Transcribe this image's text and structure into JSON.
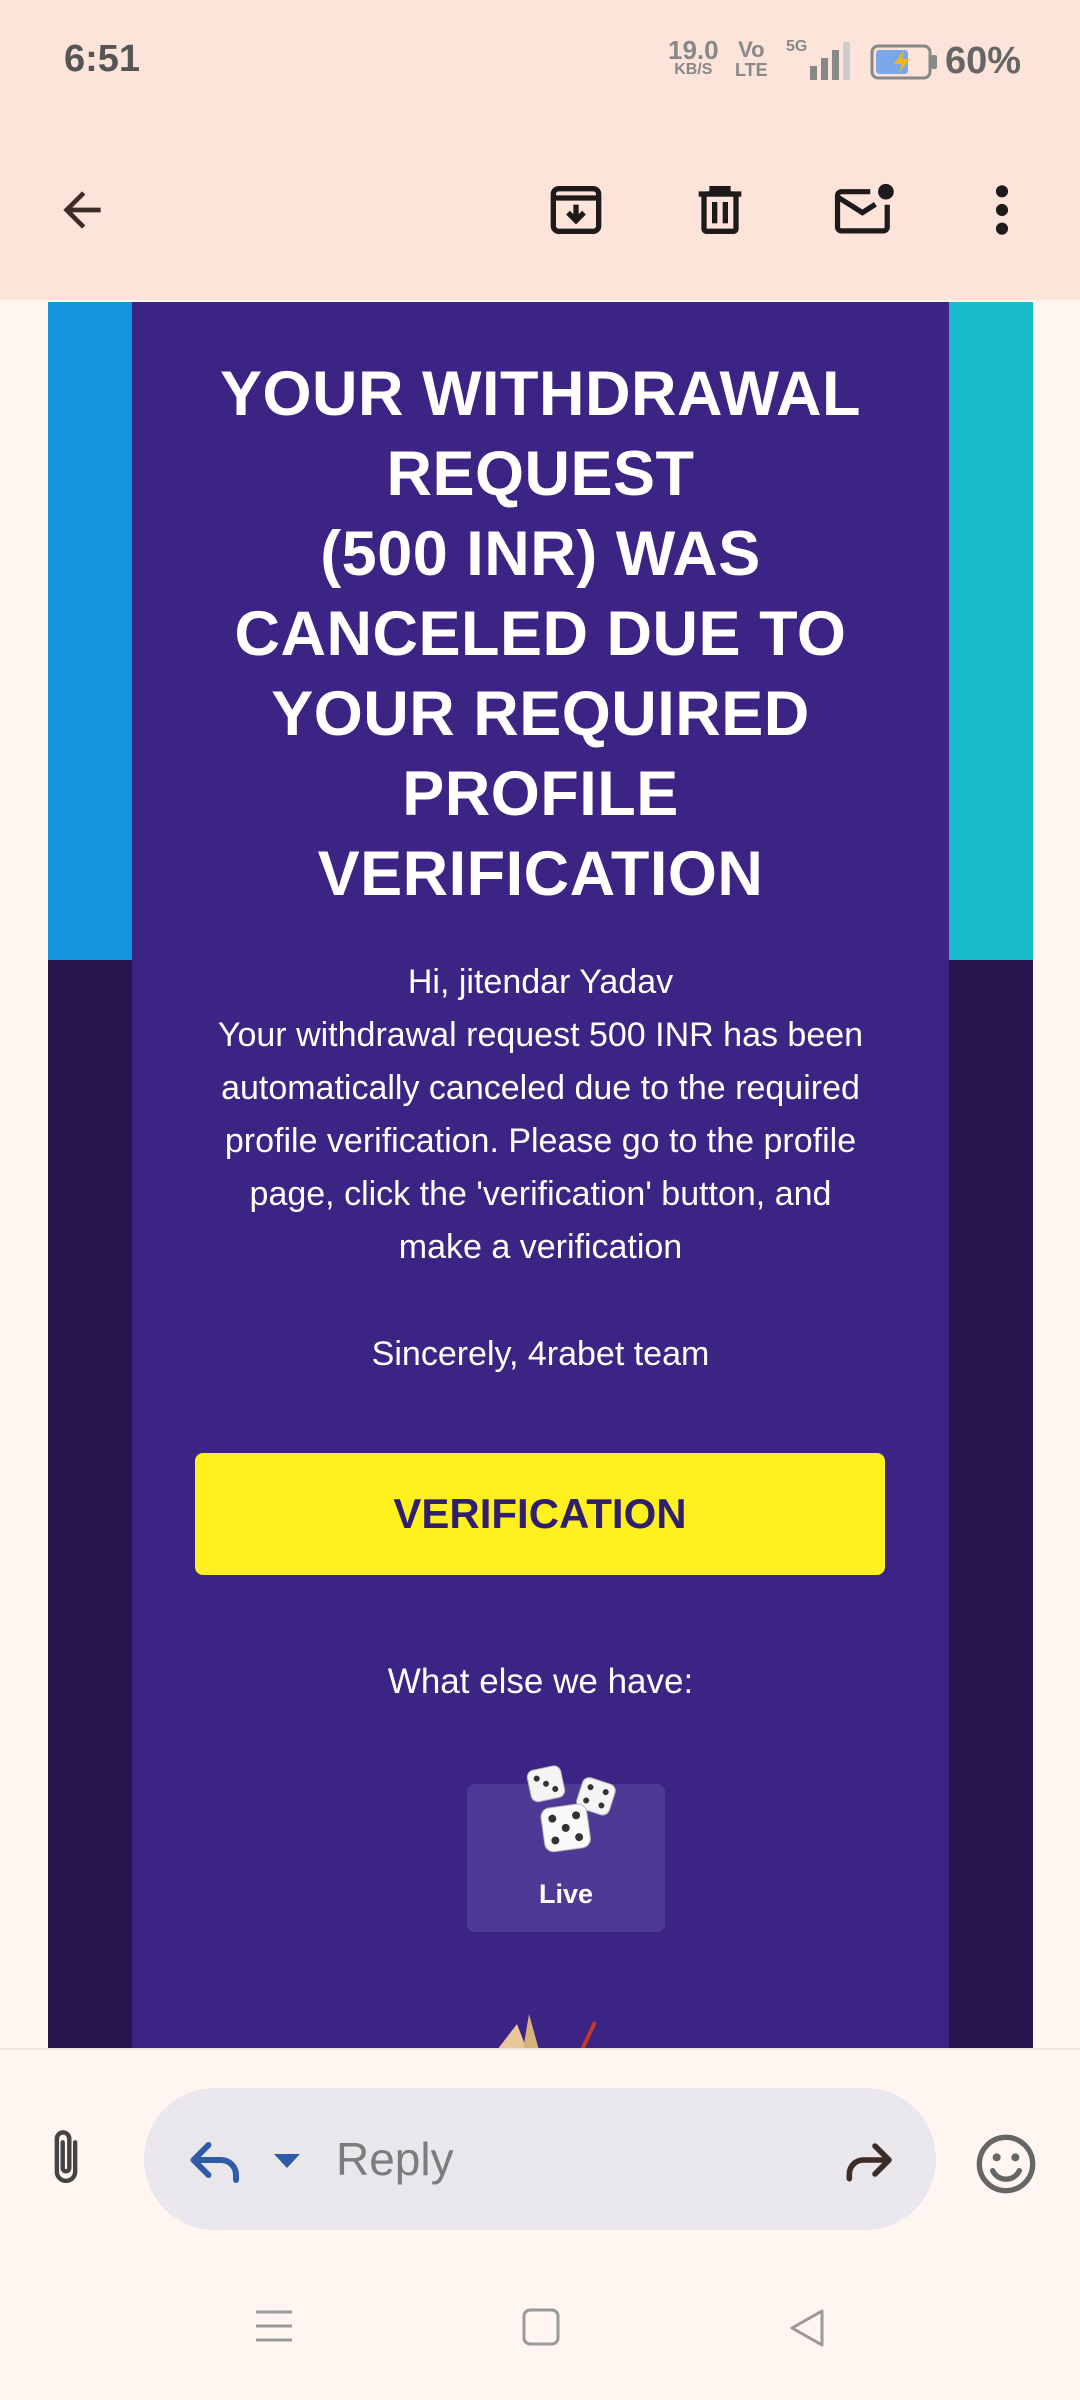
{
  "status_bar": {
    "time": "6:51",
    "net_speed_value": "19.0",
    "net_speed_unit": "KB/S",
    "volte_top": "Vo",
    "volte_bottom": "LTE",
    "network": "5G",
    "battery_percent": "60%"
  },
  "toolbar": {
    "back_icon": "arrow-left-icon",
    "archive_icon": "archive-icon",
    "delete_icon": "trash-icon",
    "mark_unread_icon": "mail-unread-icon",
    "more_icon": "more-vert-icon"
  },
  "email": {
    "headline_lines": [
      "YOUR WITHDRAWAL",
      "REQUEST",
      "(500 INR) WAS",
      "CANCELED DUE TO",
      "YOUR REQUIRED",
      "PROFILE",
      "VERIFICATION"
    ],
    "greeting": "Hi, jitendar Yadav",
    "message_lines": [
      "Your withdrawal request 500 INR has been",
      "automatically canceled due to the required",
      "profile verification. Please go to the profile",
      "page, click the 'verification' button, and",
      "make a verification"
    ],
    "signoff": "Sincerely, 4rabet team",
    "verify_button": "VERIFICATION",
    "what_else": "What else we have:",
    "live_label": "Live",
    "colors": {
      "left_stripe": "#1496de",
      "right_stripe": "#18bccc",
      "content_bg": "#3b2483",
      "outer_bg": "#27154f",
      "button_bg": "#fff01e",
      "button_text": "#2f1f6e"
    }
  },
  "reply_bar": {
    "attach_icon": "paperclip-icon",
    "reply_icon": "reply-icon",
    "reply_placeholder": "Reply",
    "forward_icon": "forward-icon",
    "emoji_icon": "emoji-icon"
  },
  "nav_bar": {
    "recents_icon": "menu-icon",
    "home_icon": "home-square-icon",
    "back_icon": "back-triangle-icon"
  }
}
